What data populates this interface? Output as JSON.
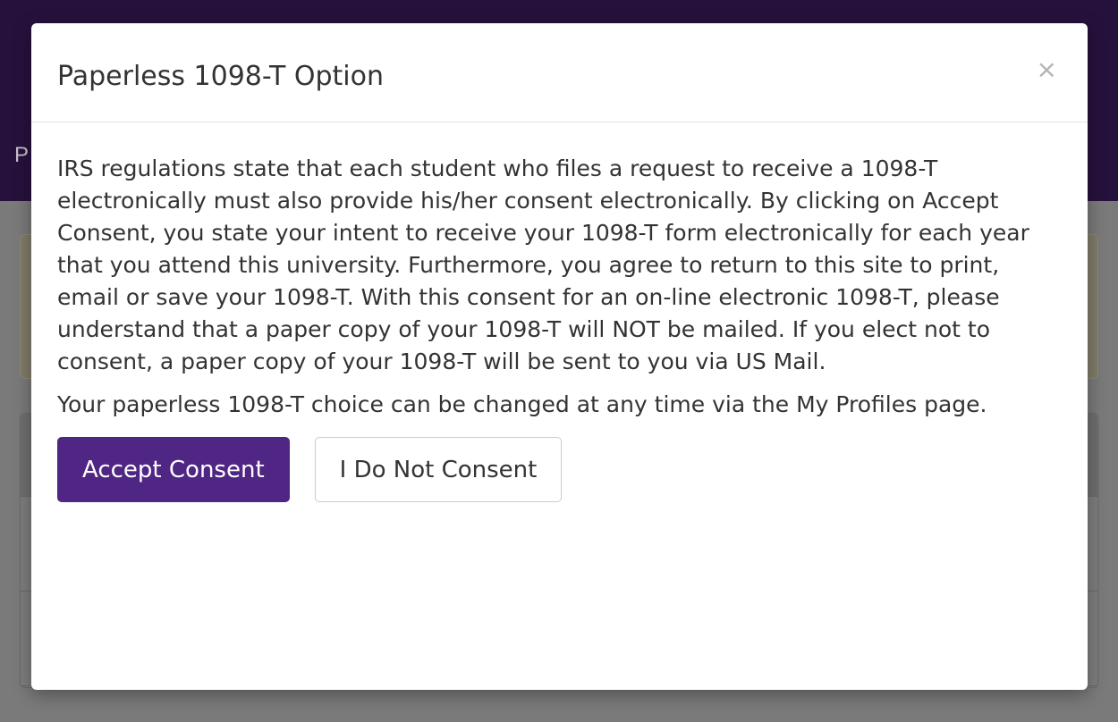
{
  "background": {
    "header_fragment": "P"
  },
  "modal": {
    "title": "Paperless 1098-T Option",
    "close_symbol": "×",
    "paragraphs": [
      "IRS regulations state that each student who files a request to receive a 1098-T electronically must also provide his/her consent electronically. By clicking on Accept Consent, you state your intent to receive your 1098-T form electronically for each year that you attend this university. Furthermore, you agree to return to this site to print, email or save your 1098-T. With this consent for an on-line electronic 1098-T, please understand that a paper copy of your 1098-T will NOT be mailed. If you elect not to consent, a paper copy of your 1098-T will be sent to you via US Mail.",
      "Your paperless 1098-T choice can be changed at any time via the My Profiles page."
    ],
    "accept_label": "Accept Consent",
    "decline_label": "I Do Not Consent"
  },
  "colors": {
    "header_bg": "#26113c",
    "primary_button": "#4f2683"
  }
}
